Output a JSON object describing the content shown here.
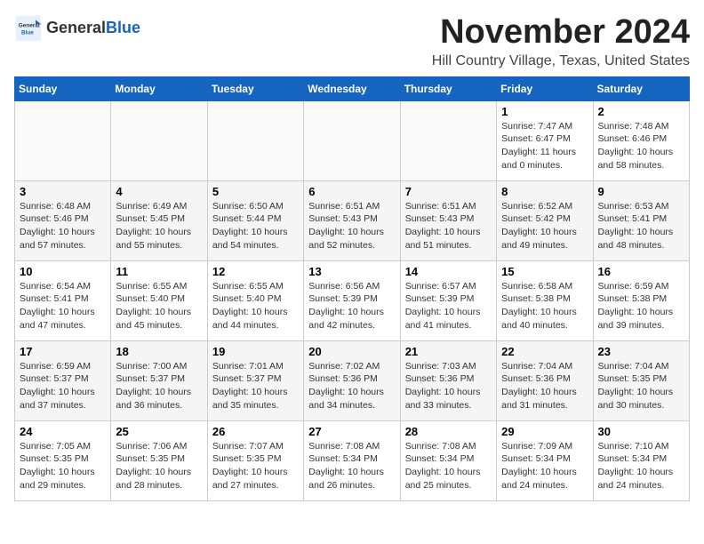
{
  "logo": {
    "general": "General",
    "blue": "Blue"
  },
  "title": {
    "month": "November 2024",
    "location": "Hill Country Village, Texas, United States"
  },
  "headers": [
    "Sunday",
    "Monday",
    "Tuesday",
    "Wednesday",
    "Thursday",
    "Friday",
    "Saturday"
  ],
  "weeks": [
    [
      {
        "day": "",
        "info": ""
      },
      {
        "day": "",
        "info": ""
      },
      {
        "day": "",
        "info": ""
      },
      {
        "day": "",
        "info": ""
      },
      {
        "day": "",
        "info": ""
      },
      {
        "day": "1",
        "info": "Sunrise: 7:47 AM\nSunset: 6:47 PM\nDaylight: 11 hours and 0 minutes."
      },
      {
        "day": "2",
        "info": "Sunrise: 7:48 AM\nSunset: 6:46 PM\nDaylight: 10 hours and 58 minutes."
      }
    ],
    [
      {
        "day": "3",
        "info": "Sunrise: 6:48 AM\nSunset: 5:46 PM\nDaylight: 10 hours and 57 minutes."
      },
      {
        "day": "4",
        "info": "Sunrise: 6:49 AM\nSunset: 5:45 PM\nDaylight: 10 hours and 55 minutes."
      },
      {
        "day": "5",
        "info": "Sunrise: 6:50 AM\nSunset: 5:44 PM\nDaylight: 10 hours and 54 minutes."
      },
      {
        "day": "6",
        "info": "Sunrise: 6:51 AM\nSunset: 5:43 PM\nDaylight: 10 hours and 52 minutes."
      },
      {
        "day": "7",
        "info": "Sunrise: 6:51 AM\nSunset: 5:43 PM\nDaylight: 10 hours and 51 minutes."
      },
      {
        "day": "8",
        "info": "Sunrise: 6:52 AM\nSunset: 5:42 PM\nDaylight: 10 hours and 49 minutes."
      },
      {
        "day": "9",
        "info": "Sunrise: 6:53 AM\nSunset: 5:41 PM\nDaylight: 10 hours and 48 minutes."
      }
    ],
    [
      {
        "day": "10",
        "info": "Sunrise: 6:54 AM\nSunset: 5:41 PM\nDaylight: 10 hours and 47 minutes."
      },
      {
        "day": "11",
        "info": "Sunrise: 6:55 AM\nSunset: 5:40 PM\nDaylight: 10 hours and 45 minutes."
      },
      {
        "day": "12",
        "info": "Sunrise: 6:55 AM\nSunset: 5:40 PM\nDaylight: 10 hours and 44 minutes."
      },
      {
        "day": "13",
        "info": "Sunrise: 6:56 AM\nSunset: 5:39 PM\nDaylight: 10 hours and 42 minutes."
      },
      {
        "day": "14",
        "info": "Sunrise: 6:57 AM\nSunset: 5:39 PM\nDaylight: 10 hours and 41 minutes."
      },
      {
        "day": "15",
        "info": "Sunrise: 6:58 AM\nSunset: 5:38 PM\nDaylight: 10 hours and 40 minutes."
      },
      {
        "day": "16",
        "info": "Sunrise: 6:59 AM\nSunset: 5:38 PM\nDaylight: 10 hours and 39 minutes."
      }
    ],
    [
      {
        "day": "17",
        "info": "Sunrise: 6:59 AM\nSunset: 5:37 PM\nDaylight: 10 hours and 37 minutes."
      },
      {
        "day": "18",
        "info": "Sunrise: 7:00 AM\nSunset: 5:37 PM\nDaylight: 10 hours and 36 minutes."
      },
      {
        "day": "19",
        "info": "Sunrise: 7:01 AM\nSunset: 5:37 PM\nDaylight: 10 hours and 35 minutes."
      },
      {
        "day": "20",
        "info": "Sunrise: 7:02 AM\nSunset: 5:36 PM\nDaylight: 10 hours and 34 minutes."
      },
      {
        "day": "21",
        "info": "Sunrise: 7:03 AM\nSunset: 5:36 PM\nDaylight: 10 hours and 33 minutes."
      },
      {
        "day": "22",
        "info": "Sunrise: 7:04 AM\nSunset: 5:36 PM\nDaylight: 10 hours and 31 minutes."
      },
      {
        "day": "23",
        "info": "Sunrise: 7:04 AM\nSunset: 5:35 PM\nDaylight: 10 hours and 30 minutes."
      }
    ],
    [
      {
        "day": "24",
        "info": "Sunrise: 7:05 AM\nSunset: 5:35 PM\nDaylight: 10 hours and 29 minutes."
      },
      {
        "day": "25",
        "info": "Sunrise: 7:06 AM\nSunset: 5:35 PM\nDaylight: 10 hours and 28 minutes."
      },
      {
        "day": "26",
        "info": "Sunrise: 7:07 AM\nSunset: 5:35 PM\nDaylight: 10 hours and 27 minutes."
      },
      {
        "day": "27",
        "info": "Sunrise: 7:08 AM\nSunset: 5:34 PM\nDaylight: 10 hours and 26 minutes."
      },
      {
        "day": "28",
        "info": "Sunrise: 7:08 AM\nSunset: 5:34 PM\nDaylight: 10 hours and 25 minutes."
      },
      {
        "day": "29",
        "info": "Sunrise: 7:09 AM\nSunset: 5:34 PM\nDaylight: 10 hours and 24 minutes."
      },
      {
        "day": "30",
        "info": "Sunrise: 7:10 AM\nSunset: 5:34 PM\nDaylight: 10 hours and 24 minutes."
      }
    ]
  ]
}
